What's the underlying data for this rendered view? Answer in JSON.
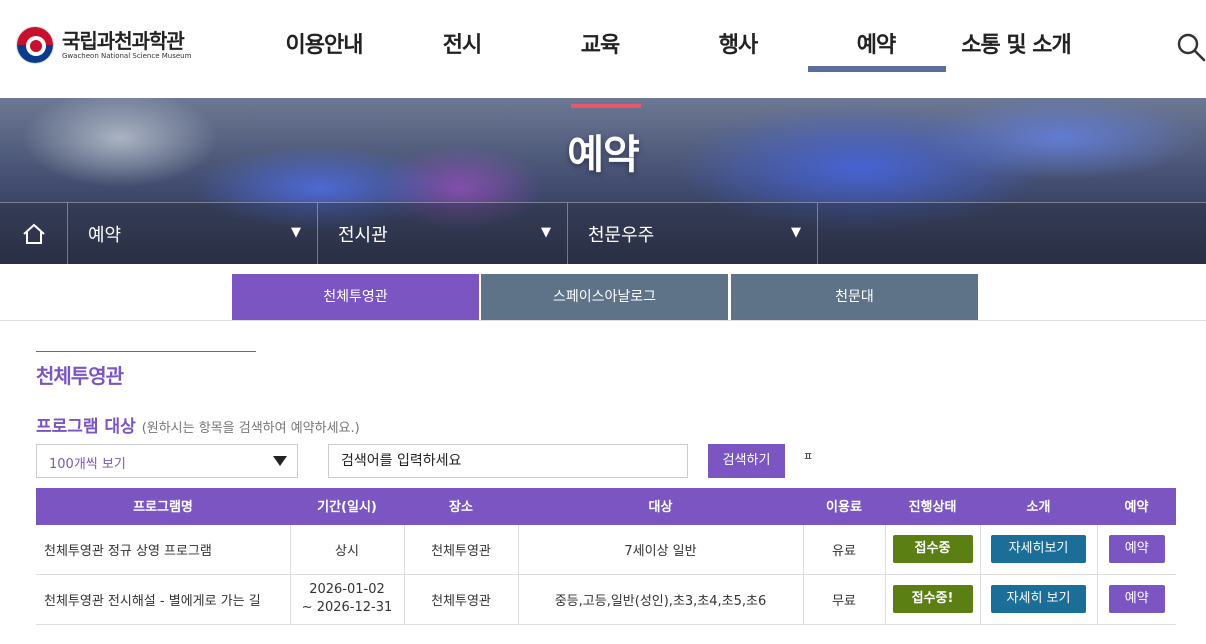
{
  "header": {
    "logo_kr": "국립과천과학관",
    "logo_en": "Gwacheon National Science Museum",
    "nav": [
      "이용안내",
      "전시",
      "교육",
      "행사",
      "예약",
      "소통 및 소개"
    ],
    "active_nav": "예약",
    "search_icon": "search-icon"
  },
  "banner": {
    "title": "예약",
    "location": {
      "home_icon": "home-icon",
      "items": [
        "예약",
        "전시관",
        "천문우주"
      ]
    }
  },
  "tabs": [
    {
      "label": "천체투영관",
      "active": true
    },
    {
      "label": "스페이스아날로그",
      "active": false
    },
    {
      "label": "천문대",
      "active": false
    }
  ],
  "section": {
    "title": "천체투영관",
    "program_label": "프로그램 대상",
    "program_help": "(원하시는 항목을 검색하여 예약하세요.)"
  },
  "filters": {
    "page_size": "100개씩 보기",
    "search_placeholder": "검색어를 입력하세요",
    "search_button": "검색하기",
    "misc_glyph": "ㅍ"
  },
  "table": {
    "columns": [
      "프로그램명",
      "기간(일시)",
      "장소",
      "대상",
      "이용료",
      "진행상태",
      "소개",
      "예약"
    ],
    "rows": [
      {
        "name": "천체투영관 정규 상영 프로그램",
        "period": "상시",
        "period2": "",
        "place": "천체투영관",
        "target": "7세이상 일반",
        "fee": "유료",
        "status": "접수중",
        "detail": "자세히보기",
        "reserve": "예약"
      },
      {
        "name": "천체투영관 전시해설 - 별에게로 가는 길",
        "period": "2026-01-02",
        "period2": "~ 2026-12-31",
        "place": "천체투영관",
        "target": "중등,고등,일반(성인),초3,초4,초5,초6",
        "fee": "무료",
        "status": "접수중!",
        "detail": "자세히 보기",
        "reserve": "예약"
      }
    ]
  },
  "colors": {
    "accent": "#7b56c2",
    "tab_inactive": "#5e7387",
    "nav_active_bar": "#5a6f99",
    "status_green": "#5b7f12",
    "detail_blue": "#1b6e97",
    "banner_red": "#e8586b"
  }
}
